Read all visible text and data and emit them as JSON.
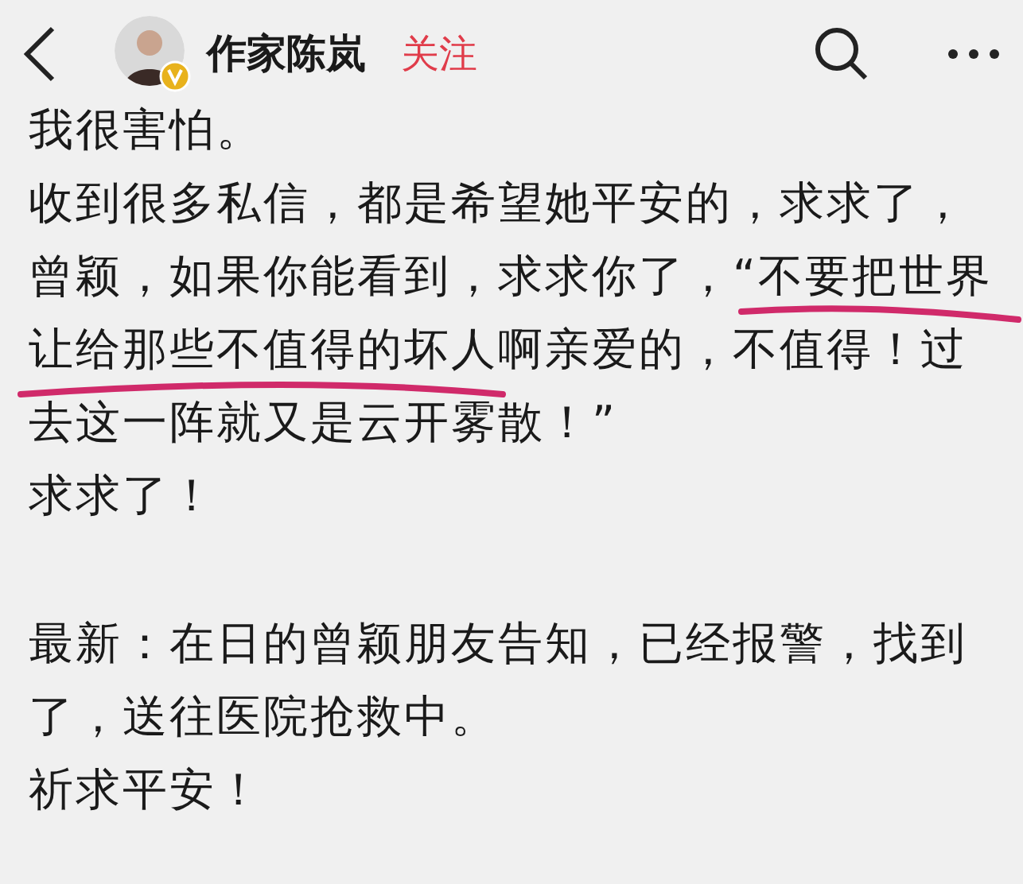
{
  "header": {
    "author": "作家陈岚",
    "follow": "关注",
    "verified": true
  },
  "sections": [
    {
      "paragraphs": [
        {
          "lines": [
            "我很害怕。"
          ]
        },
        {
          "lines": [
            "收到很多私信，都是希望她平安的，求求了，",
            "曾颖，如果你能看到，求求你了，“不要把世界",
            "让给那些不值得的坏人啊亲爱的，不值得！过",
            "去这一阵就又是云开雾散！”"
          ]
        },
        {
          "lines": [
            "求求了！"
          ]
        }
      ]
    },
    {
      "paragraphs": [
        {
          "lines": [
            "最新：在日的曾颖朋友告知，已经报警，找到",
            "了，送往医院抢救中。"
          ]
        },
        {
          "lines": [
            "祈求平安！"
          ]
        }
      ]
    }
  ]
}
